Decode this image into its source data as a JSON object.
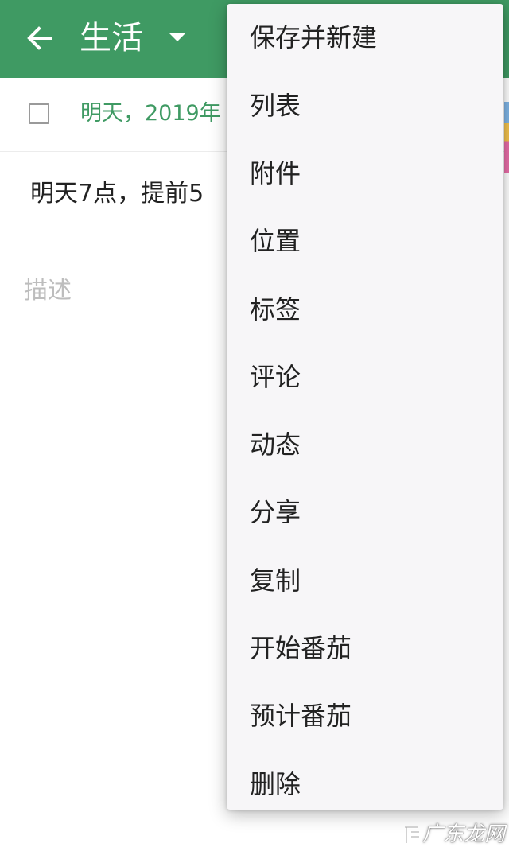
{
  "app_bar": {
    "background": "#3f9a63",
    "back_icon": "arrow-left-icon",
    "list_name": "生活",
    "dropdown_icon": "caret-down-icon"
  },
  "task": {
    "due_date": "明天，2019年",
    "title": "明天7点，提前5",
    "description_placeholder": "描述",
    "accent_color": "#3f9a63"
  },
  "menu": {
    "items": [
      {
        "label": "保存并新建"
      },
      {
        "label": "列表"
      },
      {
        "label": "附件"
      },
      {
        "label": "位置"
      },
      {
        "label": "标签"
      },
      {
        "label": "评论"
      },
      {
        "label": "动态"
      },
      {
        "label": "分享"
      },
      {
        "label": "复制"
      },
      {
        "label": "开始番茄"
      },
      {
        "label": "预计番茄"
      },
      {
        "label": "删除"
      }
    ]
  },
  "watermark": {
    "text": "广东龙网"
  }
}
